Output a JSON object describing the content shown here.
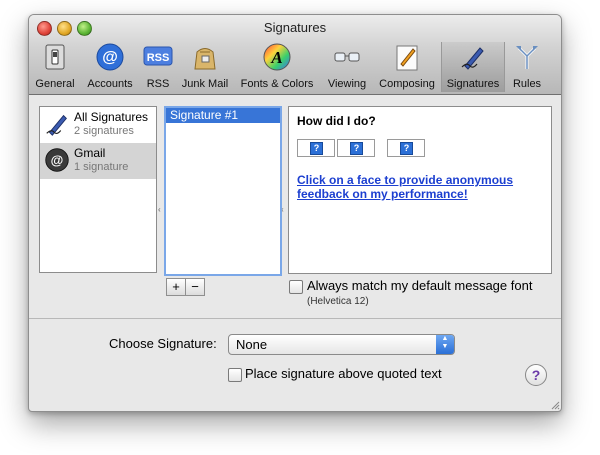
{
  "window": {
    "title": "Signatures"
  },
  "toolbar": {
    "items": [
      {
        "label": "General",
        "icon": "general-switch-icon"
      },
      {
        "label": "Accounts",
        "icon": "at-sign-icon"
      },
      {
        "label": "RSS",
        "icon": "rss-icon"
      },
      {
        "label": "Junk Mail",
        "icon": "junk-mail-bag-icon"
      },
      {
        "label": "Fonts & Colors",
        "icon": "fonts-colors-icon"
      },
      {
        "label": "Viewing",
        "icon": "glasses-icon"
      },
      {
        "label": "Composing",
        "icon": "pencil-paper-icon"
      },
      {
        "label": "Signatures",
        "icon": "signature-pen-icon"
      },
      {
        "label": "Rules",
        "icon": "rules-icon"
      }
    ],
    "selected": "Signatures"
  },
  "accounts": [
    {
      "name": "All Signatures",
      "count": "2 signatures",
      "icon": "signature-pen-icon"
    },
    {
      "name": "Gmail",
      "count": "1 signature",
      "icon": "at-sign-icon"
    }
  ],
  "signatures": {
    "items": [
      "Signature #1"
    ]
  },
  "preview": {
    "heading": "How did I do?",
    "faces": [
      "?",
      "?",
      "?"
    ],
    "link_text": "Click on a face to provide anonymous feedback on my performance!"
  },
  "font_option": {
    "label": "Always match my default message font",
    "font": "(Helvetica 12)",
    "checked": false
  },
  "choose_signature": {
    "label": "Choose Signature:",
    "value": "None"
  },
  "place_above": {
    "label": "Place signature above quoted text",
    "checked": false
  },
  "buttons": {
    "add": "+",
    "remove": "−",
    "help": "?"
  },
  "colors": {
    "selection": "#3875d7",
    "link": "#1c3fd0",
    "help": "#6b3aa8"
  }
}
